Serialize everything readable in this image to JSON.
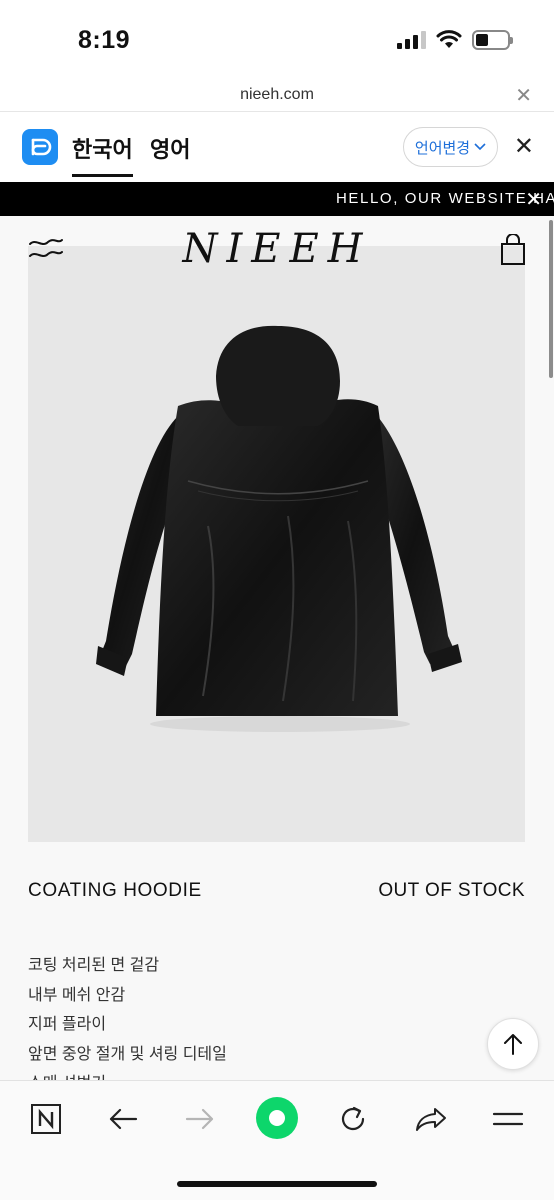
{
  "status_bar": {
    "time": "8:19"
  },
  "browser": {
    "url": "nieeh.com"
  },
  "translate_bar": {
    "tab_korean": "한국어",
    "tab_english": "영어",
    "change_language": "언어변경",
    "accent_color": "#1e8df2"
  },
  "announcement": {
    "text": "HELLO, OUR WEBSITE HAS B"
  },
  "site": {
    "brand": "NIEEH"
  },
  "product": {
    "name": "COATING HOODIE",
    "stock_status": "OUT OF STOCK",
    "features": [
      "코팅 처리된 면 겉감",
      "내부 메쉬 안감",
      "지퍼 플라이",
      "앞면 중앙 절개 및 셔링 디테일",
      "소매 셔벙기"
    ]
  },
  "icons": {
    "menu": "menu-wave-icon",
    "bag": "shopping-bag-icon",
    "scroll_top": "arrow-up-icon",
    "toolbar": [
      "naver-n-icon",
      "back-arrow-icon",
      "forward-arrow-icon",
      "green-dot-icon",
      "reload-icon",
      "share-icon",
      "hamburger-icon"
    ]
  }
}
